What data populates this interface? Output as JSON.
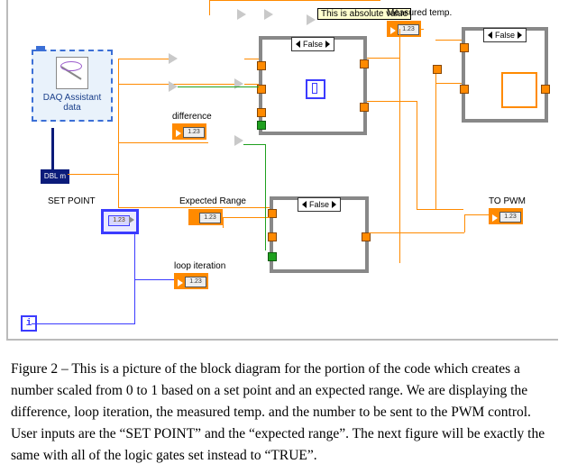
{
  "daq": {
    "line1": "DAQ Assistant",
    "line2": "data"
  },
  "labels": {
    "difference": "difference",
    "set_point": "SET POINT",
    "expected_range": "Expected Range",
    "loop_iteration": "loop iteration",
    "measured_temp": "Measured temp.",
    "to_pwm": "TO PWM",
    "tip_abs": "This is absolute value"
  },
  "case1": {
    "selector": "False"
  },
  "case2": {
    "selector": "False"
  },
  "case3": {
    "selector": "False"
  },
  "dyn_data_text": "DBL m",
  "indicator_badge": "1.23",
  "control_badge": "1.23",
  "caption": "Figure 2 – This is a picture of the block diagram for the portion of the code which creates a number scaled from 0 to 1 based on a set point and an expected range.  We are displaying the difference, loop iteration, the measured temp. and the number to be sent to the PWM control.  User inputs are the “SET POINT” and the “expected range”.  The next figure will be exactly the same with all of the logic gates set instead to “TRUE”."
}
